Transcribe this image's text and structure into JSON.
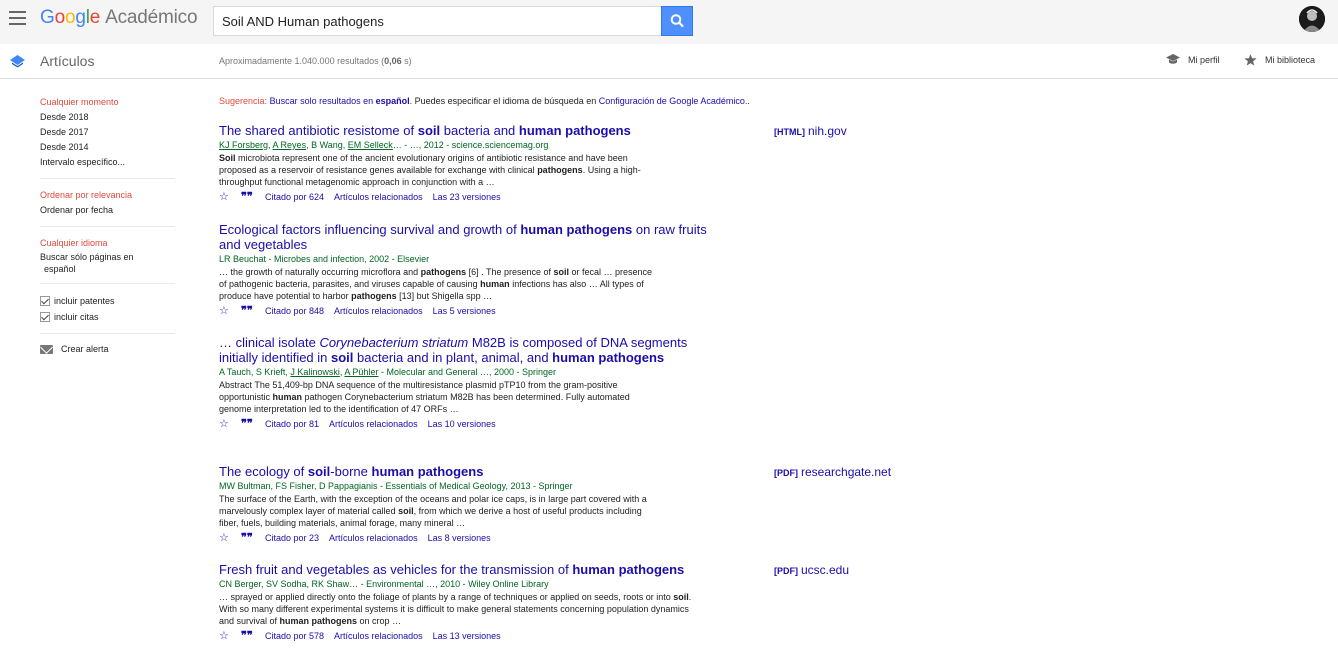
{
  "header": {
    "logo_parts": [
      "G",
      "o",
      "o",
      "g",
      "l",
      "e"
    ],
    "logo_suffix": "Académico",
    "search_value": "Soil AND Human pathogens"
  },
  "subheader": {
    "title": "Artículos",
    "results_prefix": "Aproximadamente 1.040.000 resultados (",
    "results_time": "0,06",
    "results_suffix": " s)",
    "profile_label": "Mi perfil",
    "library_label": "Mi biblioteca"
  },
  "sidebar": {
    "time_filters": [
      "Cualquier momento",
      "Desde 2018",
      "Desde 2017",
      "Desde 2014",
      "Intervalo específico..."
    ],
    "sort_options": [
      "Ordenar por relevancia",
      "Ordenar por fecha"
    ],
    "language_options": [
      "Cualquier idioma",
      "Buscar sólo páginas en",
      "español"
    ],
    "checkboxes": [
      "incluir patentes",
      "incluir citas"
    ],
    "alert_label": "Crear alerta"
  },
  "suggestion": {
    "label": "Sugerencia:",
    "link_prefix": "Buscar solo resultados en ",
    "link_lang": "español",
    "middle": ". Puedes especificar el idioma de búsqueda en ",
    "settings_link": "Configuración de Google Académico",
    "end": ".."
  },
  "results": [
    {
      "title_parts": [
        "The shared antibiotic resistome of ",
        "soil",
        " bacteria and ",
        "human pathogens"
      ],
      "authors": [
        {
          "text": "KJ Forsberg",
          "link": true
        },
        {
          "text": ", ",
          "link": false
        },
        {
          "text": "A Reyes",
          "link": true
        },
        {
          "text": ", B Wang, ",
          "link": false
        },
        {
          "text": "EM Selleck",
          "link": true
        },
        {
          "text": "… - …, 2012 - science.sciencemag.org",
          "link": false
        }
      ],
      "snippet": [
        {
          "t": "Soil",
          "b": true
        },
        {
          "t": " microbiota represent one of the ancient evolutionary origins of antibiotic resistance and have been proposed as a reservoir of resistance genes available for exchange with clinical ",
          "b": false
        },
        {
          "t": "pathogens",
          "b": true
        },
        {
          "t": ". Using a high-throughput functional metagenomic approach in conjunction with a …",
          "b": false
        }
      ],
      "cited": "Citado por 624",
      "related": "Artículos relacionados",
      "versions": "Las 23 versiones",
      "side_tag": "[HTML]",
      "side_domain": "nih.gov"
    },
    {
      "title_parts": [
        "Ecological factors influencing survival and growth of ",
        "human pathogens",
        " on raw fruits and vegetables",
        ""
      ],
      "authors": [
        {
          "text": "LR Beuchat - Microbes and infection, 2002 - Elsevier",
          "link": false
        }
      ],
      "snippet": [
        {
          "t": "… the growth of naturally occurring microflora and ",
          "b": false
        },
        {
          "t": "pathogens",
          "b": true
        },
        {
          "t": " [6] . The presence of ",
          "b": false
        },
        {
          "t": "soil",
          "b": true
        },
        {
          "t": " or fecal … presence of pathogenic bacteria, parasites, and viruses capable of causing ",
          "b": false
        },
        {
          "t": "human",
          "b": true
        },
        {
          "t": " infections has also … All types of produce have potential to harbor ",
          "b": false
        },
        {
          "t": "pathogens",
          "b": true
        },
        {
          "t": " [13] but Shigella spp …",
          "b": false
        }
      ],
      "cited": "Citado por 848",
      "related": "Artículos relacionados",
      "versions": "Las 5 versiones",
      "side_tag": "",
      "side_domain": ""
    },
    {
      "title_parts": [
        "… clinical isolate ",
        "Corynebacterium striatum",
        " M82B is composed of DNA segments initially identified in ",
        "soil",
        " bacteria and in plant, animal, and ",
        "human pathogens"
      ],
      "authors": [
        {
          "text": "A Tauch, S Krieft, ",
          "link": false
        },
        {
          "text": "J Kalinowski",
          "link": true
        },
        {
          "text": ", ",
          "link": false
        },
        {
          "text": "A Pühler",
          "link": true
        },
        {
          "text": " - Molecular and General …, 2000 - Springer",
          "link": false
        }
      ],
      "snippet": [
        {
          "t": "Abstract The 51,409-bp DNA sequence of the multiresistance plasmid pTP10 from the gram-positive opportunistic ",
          "b": false
        },
        {
          "t": "human",
          "b": true
        },
        {
          "t": " pathogen Corynebacterium striatum M82B has been determined. Fully automated genome interpretation led to the identification of 47 ORFs …",
          "b": false
        }
      ],
      "cited": "Citado por 81",
      "related": "Artículos relacionados",
      "versions": "Las 10 versiones",
      "side_tag": "",
      "side_domain": ""
    },
    {
      "title_parts": [
        "The ecology of ",
        "soil",
        "-borne ",
        "human pathogens"
      ],
      "authors": [
        {
          "text": "MW Bultman, FS Fisher, D Pappagianis - Essentials of Medical Geology, 2013 - Springer",
          "link": false
        }
      ],
      "snippet": [
        {
          "t": "The surface of the Earth, with the exception of the oceans and polar ice caps, is in large part covered with a marvelously complex layer of material called ",
          "b": false
        },
        {
          "t": "soil",
          "b": true
        },
        {
          "t": ", from which we derive a host of useful products including fiber, fuels, building materials, animal forage, many mineral …",
          "b": false
        }
      ],
      "cited": "Citado por 23",
      "related": "Artículos relacionados",
      "versions": "Las 8 versiones",
      "side_tag": "[PDF]",
      "side_domain": "researchgate.net"
    },
    {
      "title_parts": [
        "Fresh fruit and vegetables as vehicles for the transmission of ",
        "human pathogens"
      ],
      "authors": [
        {
          "text": "CN Berger, SV Sodha, RK Shaw… - Environmental …, 2010 - Wiley Online Library",
          "link": false
        }
      ],
      "snippet": [
        {
          "t": "… sprayed or applied directly onto the foliage of plants by a range of techniques or applied on seeds, roots or into ",
          "b": false
        },
        {
          "t": "soil",
          "b": true
        },
        {
          "t": ". With so many different experimental systems it is difficult to make general statements concerning population dynamics and survival of ",
          "b": false
        },
        {
          "t": "human pathogens",
          "b": true
        },
        {
          "t": " on crop …",
          "b": false
        }
      ],
      "cited": "Citado por 578",
      "related": "Artículos relacionados",
      "versions": "Las 13 versiones",
      "side_tag": "[PDF]",
      "side_domain": "ucsc.edu"
    }
  ],
  "colors": {
    "link": "#1a0dab",
    "author_green": "#006621",
    "accent_red": "#dd4b39",
    "search_blue": "#4d90fe"
  }
}
